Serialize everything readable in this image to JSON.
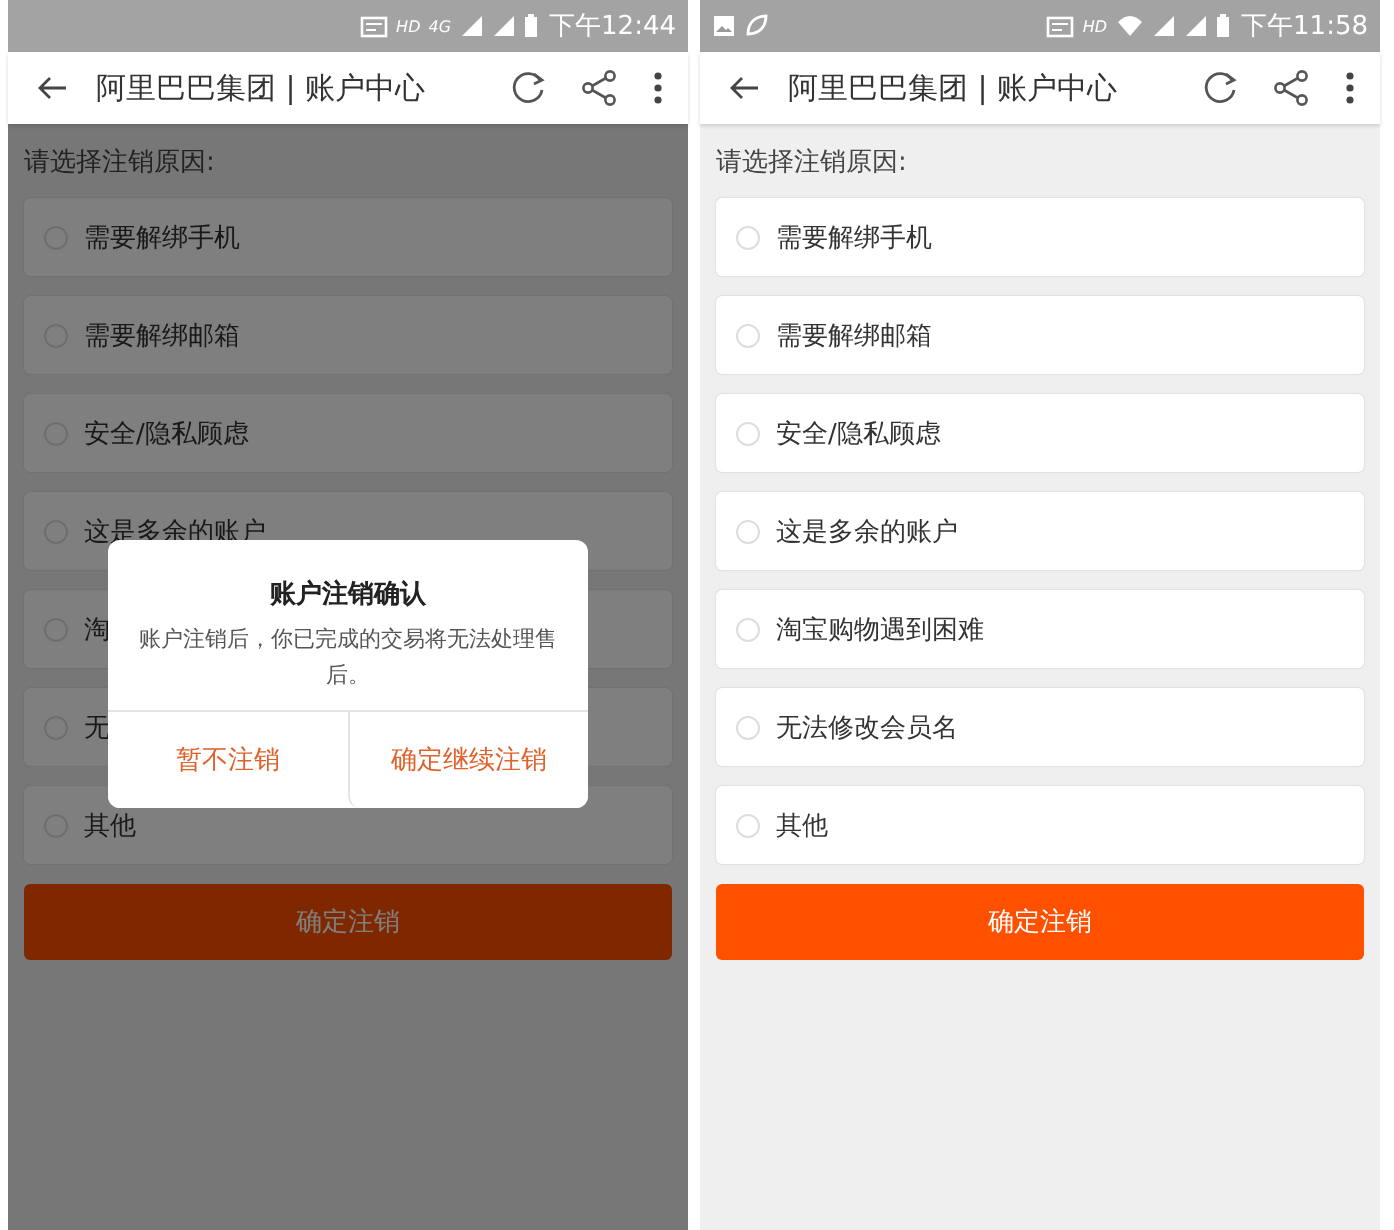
{
  "screens": [
    {
      "status_bar": {
        "badges": [
          "HD",
          "4G"
        ],
        "indicators": [
          {
            "kind": "signal"
          },
          {
            "kind": "signal"
          },
          {
            "kind": "battery"
          }
        ],
        "time": "下午12:44"
      },
      "toolbar": {
        "title": "阿里巴巴集团 | 账户中心"
      },
      "prompt": "请选择注销原因:",
      "reasons": [
        {
          "label": "需要解绑手机",
          "selected": false
        },
        {
          "label": "需要解绑邮箱",
          "selected": false
        },
        {
          "label": "安全/隐私顾虑",
          "selected": false
        },
        {
          "label": "这是多余的账户",
          "selected": false
        },
        {
          "label": "淘",
          "selected": false
        },
        {
          "label": "无",
          "selected": false
        },
        {
          "label": "其他",
          "selected": false
        }
      ],
      "submit": "确定注销",
      "dialog": {
        "title": "账户注销确认",
        "message": "账户注销后，你已完成的交易将无法处理售后。",
        "buttons": [
          "暂不注销",
          "确定继续注销"
        ]
      }
    },
    {
      "status_bar": {
        "notifications": [
          {
            "kind": "image"
          },
          {
            "kind": "app"
          }
        ],
        "badges": [
          "HD"
        ],
        "indicators": [
          {
            "kind": "wifi"
          },
          {
            "kind": "signal"
          },
          {
            "kind": "signal"
          },
          {
            "kind": "battery"
          }
        ],
        "time": "下午11:58"
      },
      "toolbar": {
        "title": "阿里巴巴集团 | 账户中心"
      },
      "prompt": "请选择注销原因:",
      "reasons": [
        {
          "label": "需要解绑手机",
          "selected": false
        },
        {
          "label": "需要解绑邮箱",
          "selected": false
        },
        {
          "label": "安全/隐私顾虑",
          "selected": false
        },
        {
          "label": "这是多余的账户",
          "selected": false
        },
        {
          "label": "淘宝购物遇到困难",
          "selected": false
        },
        {
          "label": "无法修改会员名",
          "selected": false
        },
        {
          "label": "其他",
          "selected": false
        }
      ],
      "submit": "确定注销"
    }
  ]
}
